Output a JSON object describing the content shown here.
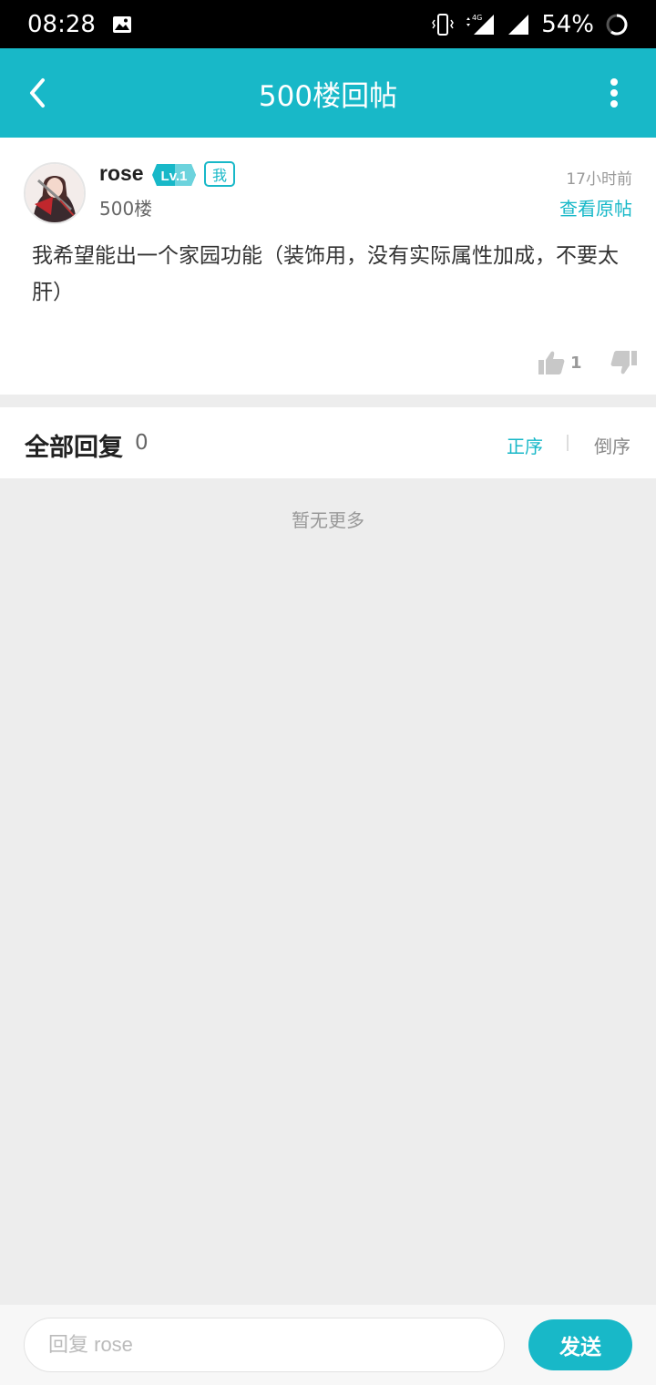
{
  "status_bar": {
    "time": "08:28",
    "battery": "54%",
    "network": "4G"
  },
  "app_bar": {
    "title": "500楼回帖"
  },
  "post": {
    "username": "rose",
    "level": "Lv.1",
    "me_tag": "我",
    "floor": "500楼",
    "time": "17小时前",
    "view_original": "查看原帖",
    "content": "我希望能出一个家园功能（装饰用，没有实际属性加成，不要太肝）",
    "like_count": "1"
  },
  "replies": {
    "title": "全部回复",
    "count": "0",
    "sort_asc": "正序",
    "sort_desc": "倒序",
    "empty_text": "暂无更多"
  },
  "bottom_bar": {
    "input_placeholder": "回复 rose",
    "send_label": "发送"
  },
  "colors": {
    "accent": "#18b8c8",
    "status_bar": "#000000",
    "background": "#ededed"
  }
}
